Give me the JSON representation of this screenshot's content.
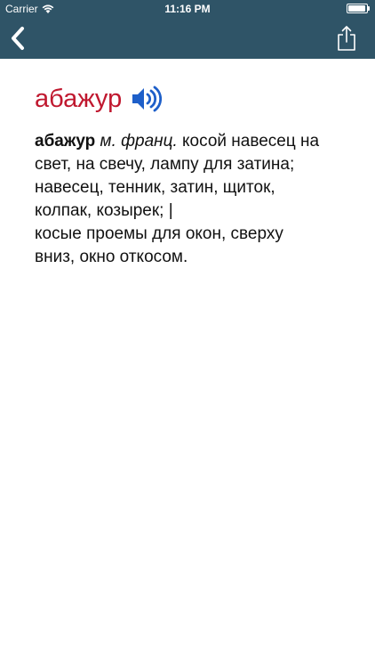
{
  "status_bar": {
    "carrier": "Carrier",
    "time": "11:16 PM"
  },
  "nav": {
    "back_icon": "chevron-left-icon",
    "share_icon": "share-icon"
  },
  "entry": {
    "headword": "абажур",
    "headword_color": "#c0182f",
    "speaker_icon": "speaker-icon",
    "term": "абажур",
    "grammar": "м. франц.",
    "definition_line1_rest": "косой навесец на",
    "definition_line2": "свет, на свечу, лампу для затина;",
    "definition_line3": "навесец, тенник, затин, щиток,",
    "definition_line4": "колпак, козырек; |",
    "definition_line5": "косые проемы для окон, сверху",
    "definition_line6": "вниз, окно откосом."
  },
  "colors": {
    "topbar": "#2f5467",
    "speaker": "#1e5fc9"
  }
}
